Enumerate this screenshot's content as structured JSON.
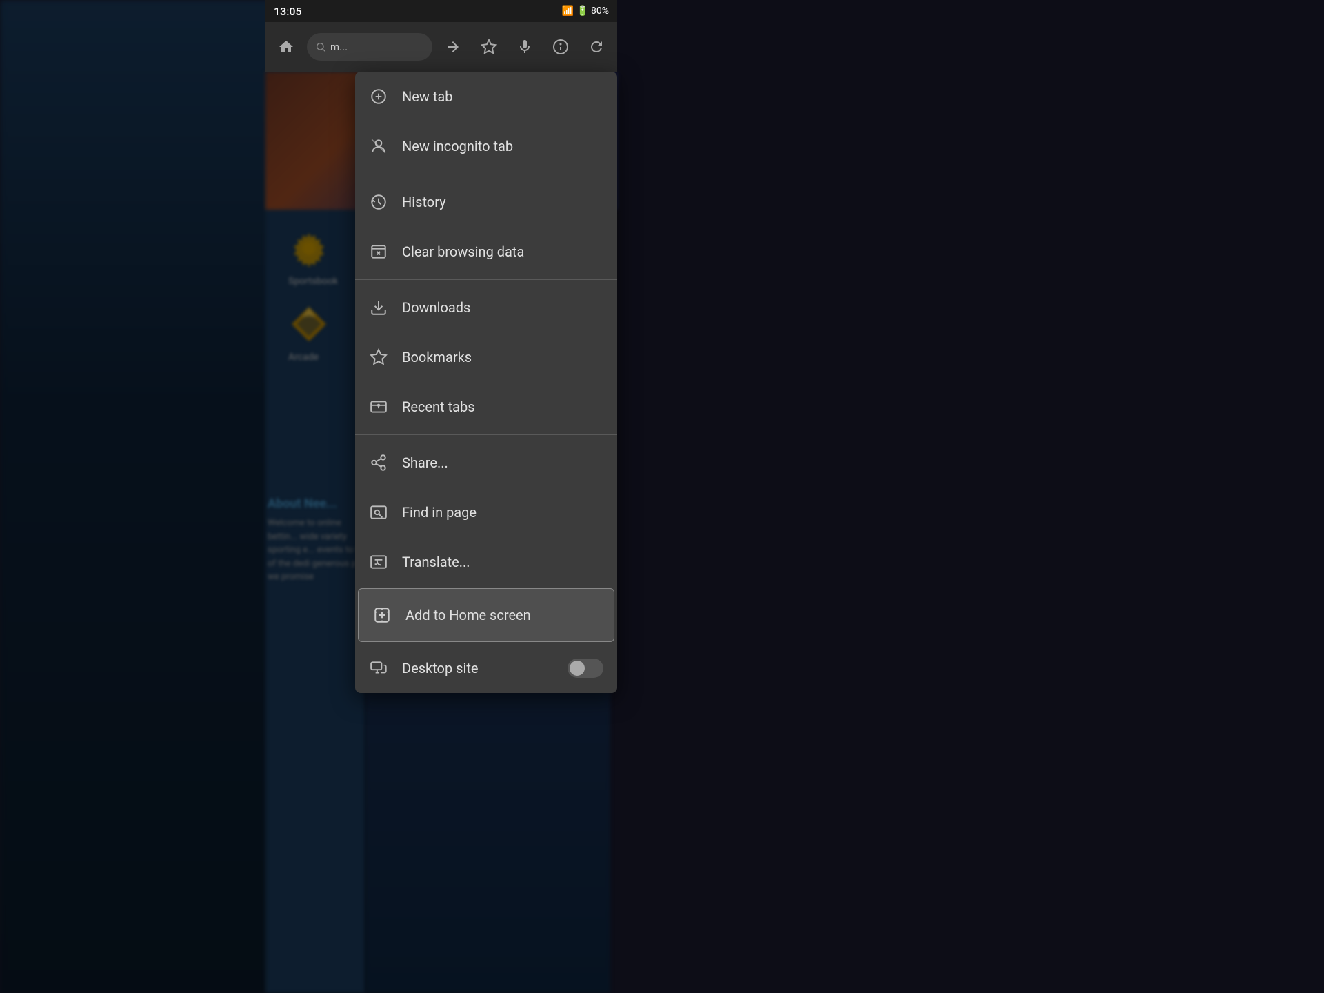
{
  "statusBar": {
    "time": "13:05",
    "batteryIcon": "🔋",
    "signalIcon": "📶"
  },
  "toolbar": {
    "homeIcon": "⌂",
    "urlText": "m...",
    "forwardIcon": "→",
    "starIcon": "☆",
    "micIcon": "🎤",
    "infoIcon": "ℹ",
    "refreshIcon": "↻"
  },
  "menu": {
    "items": [
      {
        "id": "new-tab",
        "label": "New tab",
        "icon": "new-tab-icon"
      },
      {
        "id": "new-incognito-tab",
        "label": "New incognito tab",
        "icon": "incognito-icon"
      },
      {
        "id": "history",
        "label": "History",
        "icon": "history-icon"
      },
      {
        "id": "clear-browsing-data",
        "label": "Clear browsing data",
        "icon": "clear-icon"
      },
      {
        "id": "downloads",
        "label": "Downloads",
        "icon": "downloads-icon"
      },
      {
        "id": "bookmarks",
        "label": "Bookmarks",
        "icon": "bookmarks-icon"
      },
      {
        "id": "recent-tabs",
        "label": "Recent tabs",
        "icon": "recent-tabs-icon"
      },
      {
        "id": "share",
        "label": "Share...",
        "icon": "share-icon"
      },
      {
        "id": "find-in-page",
        "label": "Find in page",
        "icon": "find-icon"
      },
      {
        "id": "translate",
        "label": "Translate...",
        "icon": "translate-icon"
      }
    ],
    "addToHomeScreen": {
      "label": "Add to Home screen",
      "icon": "add-home-icon"
    },
    "desktopSite": {
      "label": "Desktop site",
      "icon": "desktop-icon"
    }
  },
  "sidebarItems": [
    {
      "label": "Sportsbook"
    },
    {
      "label": "Arcade"
    }
  ],
  "aboutSection": {
    "title": "About Nee...",
    "text": "Welcome to online bettin... wide variety sporting e... events to th of the dedi generous p we promise"
  }
}
